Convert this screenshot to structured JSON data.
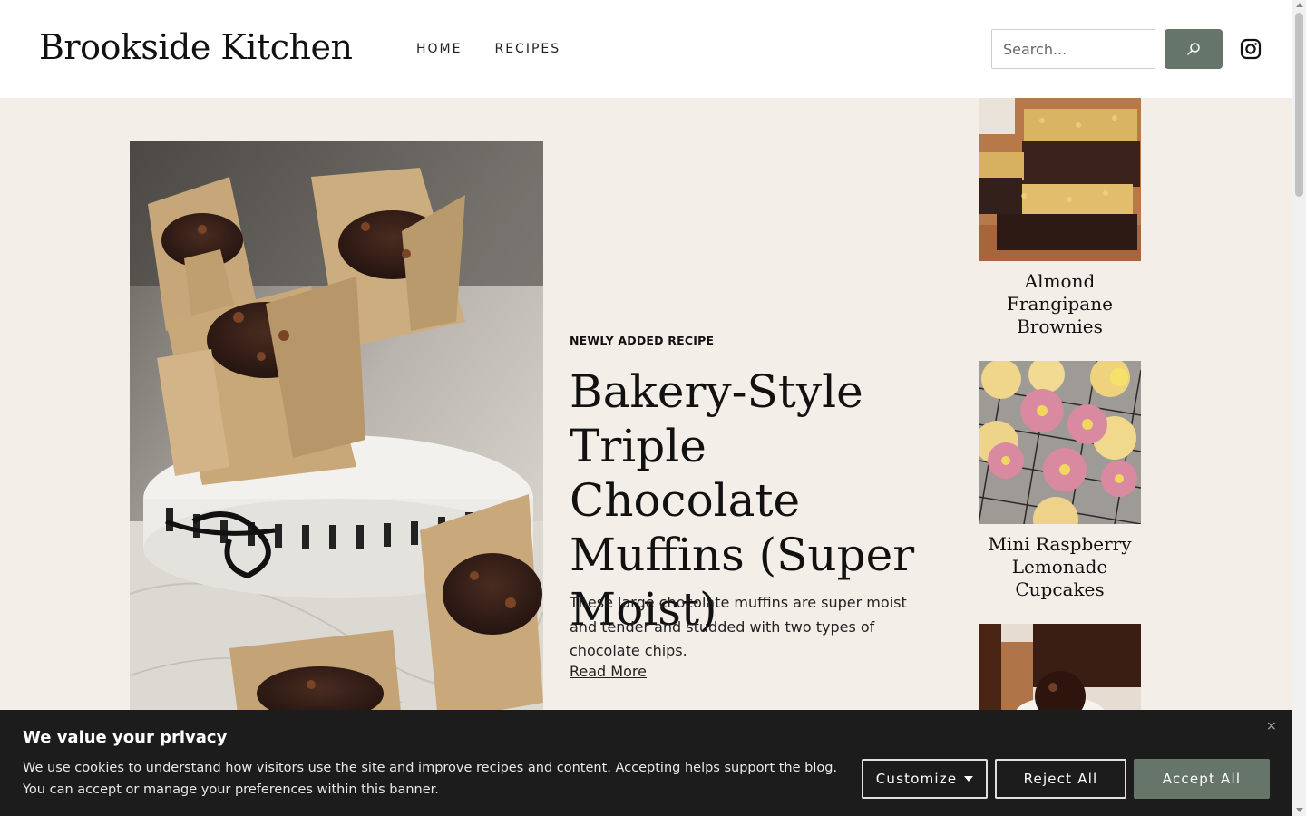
{
  "header": {
    "logo": "Brookside Kitchen",
    "nav": [
      "HOME",
      "RECIPES"
    ],
    "search_placeholder": "Search...",
    "search_icon": "search-icon",
    "social_icon": "instagram-icon"
  },
  "feature": {
    "kicker": "NEWLY ADDED RECIPE",
    "title": "Bakery-Style Triple Chocolate Muffins (Super Moist)",
    "description": "These large chocolate muffins are super moist and tender and studded with two types of chocolate chips.",
    "link": "Read More",
    "image": "chocolate-muffins-photo"
  },
  "sidebar": {
    "cards": [
      {
        "title": "Almond Frangipane Brownies",
        "image": "brownies-photo"
      },
      {
        "title": "Mini Raspberry Lemonade Cupcakes",
        "image": "cupcakes-photo"
      },
      {
        "title": "",
        "image": "chocolate-cake-photo"
      }
    ]
  },
  "cookie": {
    "title": "We value your privacy",
    "text": "We use cookies to understand how visitors use the site and improve recipes and content. Accepting helps support the blog. You can accept or manage your preferences within this banner.",
    "close": "×",
    "customize": "Customize",
    "reject": "Reject All",
    "accept": "Accept All"
  },
  "colors": {
    "accent": "#66756a",
    "page_bg": "#f3eee8",
    "banner_bg": "#1c1c1c"
  }
}
